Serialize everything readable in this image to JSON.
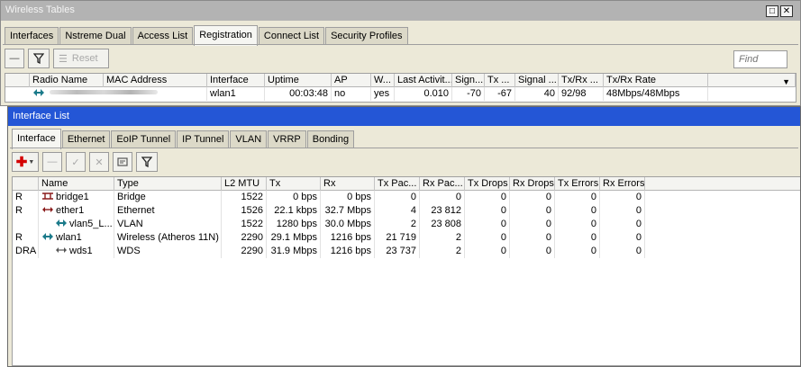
{
  "wireless_tables": {
    "title": "Wireless Tables",
    "window_buttons": [
      "□",
      "✕"
    ],
    "tabs": [
      "Interfaces",
      "Nstreme Dual",
      "Access List",
      "Registration",
      "Connect List",
      "Security Profiles"
    ],
    "active_tab": 3,
    "toolbar": {
      "reset_label": "Reset",
      "find_placeholder": "Find"
    },
    "columns": [
      "Radio Name",
      "MAC Address",
      "Interface",
      "Uptime",
      "AP",
      "W...",
      "Last Activit...",
      "Sign...",
      "Tx ...",
      "Signal ...",
      "Tx/Rx ...",
      "Tx/Rx Rate"
    ],
    "rows": [
      {
        "radio_name": "",
        "mac": "",
        "interface": "wlan1",
        "uptime": "00:03:48",
        "ap": "no",
        "w": "yes",
        "last_activity": "0.010",
        "signal": "-70",
        "tx": "-67",
        "signal2": "40",
        "txrx": "92/98",
        "txrx_rate": "48Mbps/48Mbps"
      }
    ]
  },
  "interface_list": {
    "title": "Interface List",
    "tabs": [
      "Interface",
      "Ethernet",
      "EoIP Tunnel",
      "IP Tunnel",
      "VLAN",
      "VRRP",
      "Bonding"
    ],
    "active_tab": 0,
    "columns": [
      "",
      "Name",
      "Type",
      "L2 MTU",
      "Tx",
      "Rx",
      "Tx Pac...",
      "Rx Pac...",
      "Tx Drops",
      "Rx Drops",
      "Tx Errors",
      "Rx Errors"
    ],
    "rows": [
      {
        "flags": "R",
        "name": "bridge1",
        "icon": "bridge-icon",
        "type": "Bridge",
        "l2mtu": "1522",
        "tx": "0 bps",
        "rx": "0 bps",
        "tx_pac": "0",
        "rx_pac": "0",
        "tx_drops": "0",
        "rx_drops": "0",
        "tx_errors": "0",
        "rx_errors": "0"
      },
      {
        "flags": "R",
        "name": "ether1",
        "icon": "ethernet-icon",
        "type": "Ethernet",
        "l2mtu": "1526",
        "tx": "22.1 kbps",
        "rx": "32.7 Mbps",
        "tx_pac": "4",
        "rx_pac": "23 812",
        "tx_drops": "0",
        "rx_drops": "0",
        "tx_errors": "0",
        "rx_errors": "0"
      },
      {
        "flags": "",
        "name": "vlan5_L...",
        "icon": "vlan-icon",
        "type": "VLAN",
        "l2mtu": "1522",
        "tx": "1280 bps",
        "rx": "30.0 Mbps",
        "tx_pac": "2",
        "rx_pac": "23 808",
        "tx_drops": "0",
        "rx_drops": "0",
        "tx_errors": "0",
        "rx_errors": "0"
      },
      {
        "flags": "R",
        "name": "wlan1",
        "icon": "wireless-icon",
        "type": "Wireless (Atheros 11N)",
        "l2mtu": "2290",
        "tx": "29.1 Mbps",
        "rx": "1216 bps",
        "tx_pac": "21 719",
        "rx_pac": "2",
        "tx_drops": "0",
        "rx_drops": "0",
        "tx_errors": "0",
        "rx_errors": "0"
      },
      {
        "flags": "DRA",
        "name": "wds1",
        "icon": "wds-icon",
        "type": "WDS",
        "l2mtu": "2290",
        "tx": "31.9 Mbps",
        "rx": "1216 bps",
        "tx_pac": "23 737",
        "rx_pac": "2",
        "tx_drops": "0",
        "rx_drops": "0",
        "tx_errors": "0",
        "rx_errors": "0"
      }
    ]
  },
  "colors": {
    "active_title": "#2456d6",
    "inactive_title": "#b3b3b3",
    "window_bg": "#ece9d8",
    "add_icon": "#d40000",
    "interface_icon": "#1a7a8a"
  }
}
